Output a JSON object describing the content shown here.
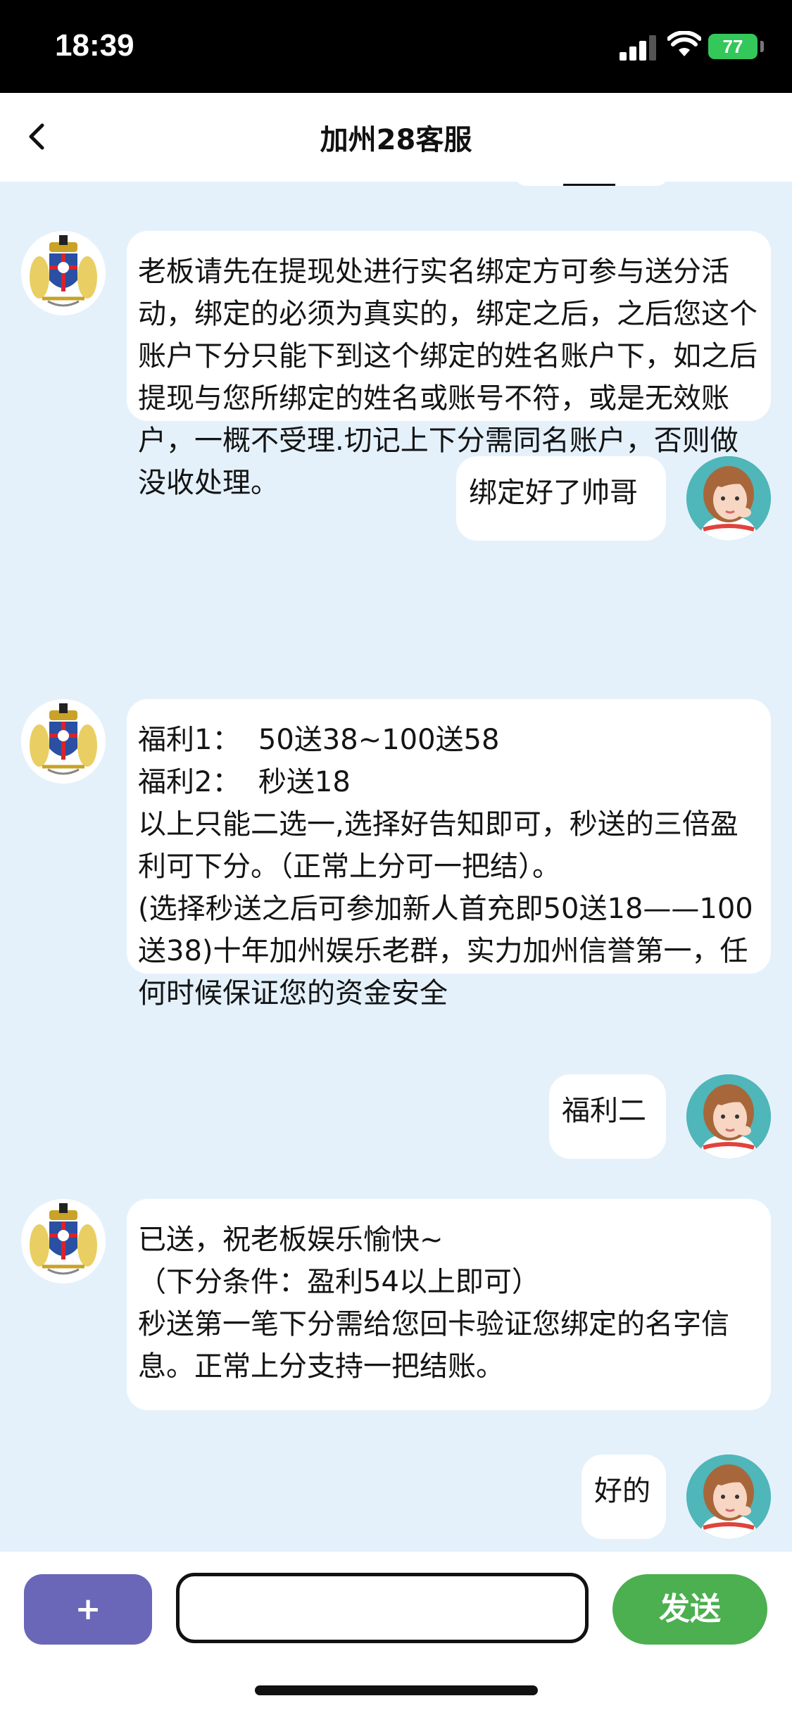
{
  "status_bar": {
    "time": "18:39",
    "battery": "77"
  },
  "nav": {
    "title": "加州28客服"
  },
  "messages": [
    {
      "sender": "bot",
      "text": "老板请先在提现处进行实名绑定方可参与送分活动，绑定的必须为真实的，绑定之后，之后您这个账户下分只能下到这个绑定的姓名账户下，如之后提现与您所绑定的姓名或账号不符，或是无效账户，一概不受理.切记上下分需同名账户，否则做没收处理。"
    },
    {
      "sender": "user",
      "text": "绑定好了帅哥"
    },
    {
      "sender": "bot",
      "text": "福利1：  50送38~100送58\n福利2：  秒送18\n以上只能二选一,选择好告知即可，秒送的三倍盈利可下分。（正常上分可一把结）。\n(选择秒送之后可参加新人首充即50送18——100送38)十年加州娱乐老群，实力加州信誉第一，任何时候保证您的资金安全"
    },
    {
      "sender": "user",
      "text": "福利二"
    },
    {
      "sender": "bot",
      "text": "已送，祝老板娱乐愉快~\n（下分条件：盈利54以上即可）\n秒送第一笔下分需给您回卡验证您绑定的名字信息。正常上分支持一把结账。"
    },
    {
      "sender": "user",
      "text": "好的"
    }
  ],
  "input": {
    "plus_label": "+",
    "placeholder": "",
    "send_label": "发送"
  },
  "colors": {
    "chat_bg": "#e4f1fb",
    "send": "#4caf50",
    "plus": "#6a67b9",
    "battery": "#34c759"
  }
}
